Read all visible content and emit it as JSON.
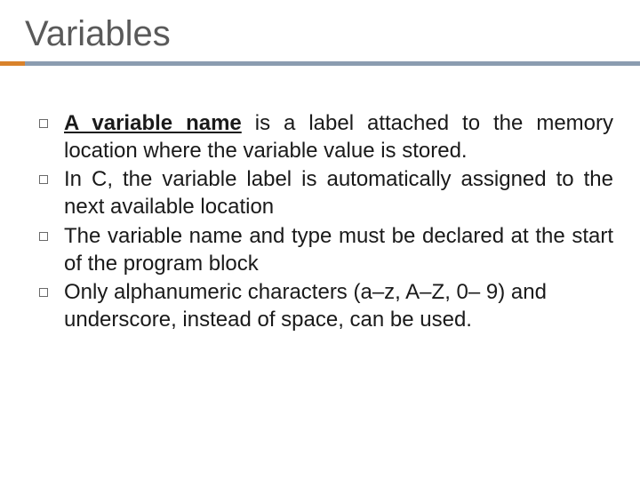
{
  "slide": {
    "title": "Variables",
    "bullets": [
      {
        "prefix": "A variable name",
        "text": " is a label attached to the memory location where the variable value is stored.",
        "justified": true,
        "hasPrefix": true
      },
      {
        "text": "In C, the variable label is automatically assigned to the next available location",
        "justified": true,
        "hasPrefix": false
      },
      {
        "text": "The variable name and type must be declared at the start of the program block",
        "justified": true,
        "hasPrefix": false
      },
      {
        "text": "Only alphanumeric characters (a–z, A–Z, 0– 9) and underscore, instead of space, can be used.",
        "justified": false,
        "hasPrefix": false
      }
    ]
  }
}
